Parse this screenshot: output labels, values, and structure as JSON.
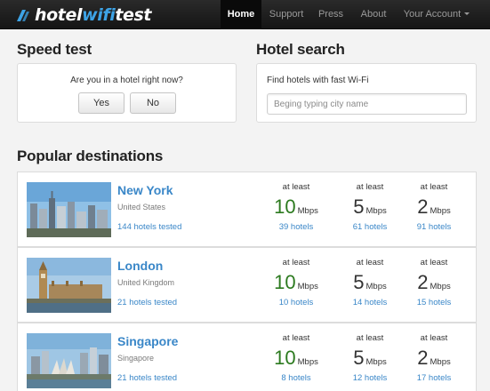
{
  "brand": {
    "part1": "hotel",
    "part2": "wifi",
    "part3": "test"
  },
  "nav": {
    "home": "Home",
    "support": "Support",
    "press": "Press",
    "about": "About",
    "account": "Your Account"
  },
  "speed_test": {
    "heading": "Speed test",
    "question": "Are you in a hotel right now?",
    "yes": "Yes",
    "no": "No"
  },
  "hotel_search": {
    "heading": "Hotel search",
    "label": "Find hotels with fast Wi-Fi",
    "placeholder": "Beging typing city name"
  },
  "popular": {
    "heading": "Popular destinations",
    "at_least": "at least",
    "unit": "Mbps",
    "destinations": [
      {
        "city": "New York",
        "country": "United States",
        "tested": "144 hotels tested",
        "speeds": [
          {
            "value": "10",
            "hotels": "39 hotels"
          },
          {
            "value": "5",
            "hotels": "61 hotels"
          },
          {
            "value": "2",
            "hotels": "91 hotels"
          }
        ]
      },
      {
        "city": "London",
        "country": "United Kingdom",
        "tested": "21 hotels tested",
        "speeds": [
          {
            "value": "10",
            "hotels": "10 hotels"
          },
          {
            "value": "5",
            "hotels": "14 hotels"
          },
          {
            "value": "2",
            "hotels": "15 hotels"
          }
        ]
      },
      {
        "city": "Singapore",
        "country": "Singapore",
        "tested": "21 hotels tested",
        "speeds": [
          {
            "value": "10",
            "hotels": "8 hotels"
          },
          {
            "value": "5",
            "hotels": "12 hotels"
          },
          {
            "value": "2",
            "hotels": "17 hotels"
          }
        ]
      }
    ]
  },
  "colors": {
    "link": "#3a87c8",
    "fast_speed": "#2c7a1f",
    "brand_accent": "#3da3e6",
    "navbar": "#1b1b1b"
  },
  "icons": {
    "brand_mark": "wifi-signal-icon",
    "account_caret": "caret-down-icon"
  }
}
